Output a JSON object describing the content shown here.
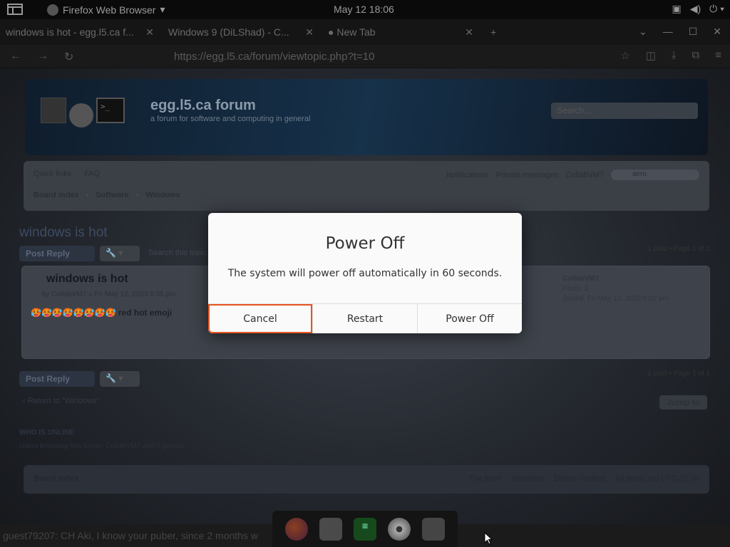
{
  "topbar": {
    "app_name": "Firefox Web Browser",
    "clock": "May 12  18:06",
    "tray_icons": [
      "screen-icon",
      "volume-icon",
      "power-icon"
    ]
  },
  "browser": {
    "tabs": [
      {
        "label": "windows is hot - egg.l5.ca f..."
      },
      {
        "label": "Windows 9 (DiLShad) - C..."
      },
      {
        "label": "New Tab"
      }
    ],
    "url": "https://egg.l5.ca/forum/viewtopic.php?t=10"
  },
  "forum": {
    "title": "egg.l5.ca forum",
    "subtitle": "a forum for software and computing in general",
    "search_placeholder": "Search...",
    "nav": {
      "quick_links": "Quick links",
      "faq": "FAQ",
      "notifications": "Notifications",
      "private_messages": "Private messages",
      "user": "CollabVM7",
      "lang": "aero"
    },
    "breadcrumbs": [
      "Board index",
      "Software",
      "Windows"
    ],
    "topic_title": "windows is hot",
    "post_reply": "Post Reply",
    "search_topic_placeholder": "Search this topic...",
    "page_info": "1 post • Page 1 of 1",
    "post": {
      "title": "windows is hot",
      "by": "by CollabVM7 » Fri May 12, 2023 6:05 pm",
      "body_emoji": "🥵🥵🥵🥵🥵🥵🥵🥵",
      "body_text": "red hot emoji",
      "author_name": "CollabVM7",
      "author_posts": "Posts: 3",
      "author_joined": "Joined: Fri May 12, 2023 6:02 pm"
    },
    "return_link": "‹  Return to \"Windows\"",
    "jump_to": "Jump to",
    "who_online": "WHO IS ONLINE",
    "users_browsing": "Users browsing this forum: CollabVM7 and 0 guests",
    "footer_index": "Board index",
    "footer_links": [
      "The team",
      "Members",
      "Delete cookies",
      "All times are UTC-07:00"
    ]
  },
  "chat": {
    "text": "guest79207: CH Aki, I know your puber, since 2 months w"
  },
  "dialog": {
    "title": "Power Off",
    "message": "The system will power off automatically in 60 seconds.",
    "cancel": "Cancel",
    "restart": "Restart",
    "power_off": "Power Off"
  },
  "colors": {
    "focus_ring": "#e95420",
    "dialog_bg": "#fafafa"
  }
}
